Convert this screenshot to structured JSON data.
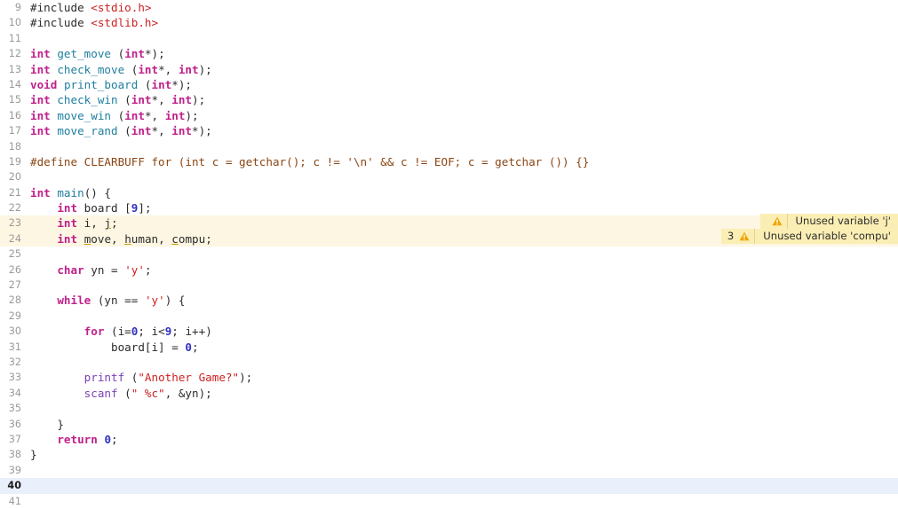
{
  "editor": {
    "first_line_number": 9,
    "active_line_number": 40,
    "warning_line_numbers": [
      23,
      24
    ],
    "colors": {
      "background": "#ffffff",
      "keyword": "#c0208a",
      "function": "#1f7f9e",
      "call": "#7b3fb8",
      "string": "#cc2222",
      "number": "#3030c0",
      "preprocessor": "#8b4513",
      "identifier": "#2b2b2b",
      "line_number": "#9a9a9a",
      "warning_line_highlight": "#fdf6e3",
      "active_line_highlight": "#eaf0fb",
      "warning_badge_background": "#fbeeb4",
      "warning_icon": "#f0a500"
    }
  },
  "lines": [
    {
      "n": 9,
      "state": "normal",
      "tokens": [
        {
          "t": "#include ",
          "c": "id"
        },
        {
          "t": "<stdio.h>",
          "c": "str"
        }
      ]
    },
    {
      "n": 10,
      "state": "normal",
      "tokens": [
        {
          "t": "#include ",
          "c": "id"
        },
        {
          "t": "<stdlib.h>",
          "c": "str"
        }
      ]
    },
    {
      "n": 11,
      "state": "normal",
      "tokens": []
    },
    {
      "n": 12,
      "state": "normal",
      "tokens": [
        {
          "t": "int",
          "c": "k"
        },
        {
          "t": " ",
          "c": "id"
        },
        {
          "t": "get_move",
          "c": "fn"
        },
        {
          "t": " (",
          "c": "id"
        },
        {
          "t": "int",
          "c": "k"
        },
        {
          "t": "*);",
          "c": "id"
        }
      ]
    },
    {
      "n": 13,
      "state": "normal",
      "tokens": [
        {
          "t": "int",
          "c": "k"
        },
        {
          "t": " ",
          "c": "id"
        },
        {
          "t": "check_move",
          "c": "fn"
        },
        {
          "t": " (",
          "c": "id"
        },
        {
          "t": "int",
          "c": "k"
        },
        {
          "t": "*, ",
          "c": "id"
        },
        {
          "t": "int",
          "c": "k"
        },
        {
          "t": ");",
          "c": "id"
        }
      ]
    },
    {
      "n": 14,
      "state": "normal",
      "tokens": [
        {
          "t": "void",
          "c": "k"
        },
        {
          "t": " ",
          "c": "id"
        },
        {
          "t": "print_board",
          "c": "fn"
        },
        {
          "t": " (",
          "c": "id"
        },
        {
          "t": "int",
          "c": "k"
        },
        {
          "t": "*);",
          "c": "id"
        }
      ]
    },
    {
      "n": 15,
      "state": "normal",
      "tokens": [
        {
          "t": "int",
          "c": "k"
        },
        {
          "t": " ",
          "c": "id"
        },
        {
          "t": "check_win",
          "c": "fn"
        },
        {
          "t": " (",
          "c": "id"
        },
        {
          "t": "int",
          "c": "k"
        },
        {
          "t": "*, ",
          "c": "id"
        },
        {
          "t": "int",
          "c": "k"
        },
        {
          "t": ");",
          "c": "id"
        }
      ]
    },
    {
      "n": 16,
      "state": "normal",
      "tokens": [
        {
          "t": "int",
          "c": "k"
        },
        {
          "t": " ",
          "c": "id"
        },
        {
          "t": "move_win",
          "c": "fn"
        },
        {
          "t": " (",
          "c": "id"
        },
        {
          "t": "int",
          "c": "k"
        },
        {
          "t": "*, ",
          "c": "id"
        },
        {
          "t": "int",
          "c": "k"
        },
        {
          "t": ");",
          "c": "id"
        }
      ]
    },
    {
      "n": 17,
      "state": "normal",
      "tokens": [
        {
          "t": "int",
          "c": "k"
        },
        {
          "t": " ",
          "c": "id"
        },
        {
          "t": "move_rand",
          "c": "fn"
        },
        {
          "t": " (",
          "c": "id"
        },
        {
          "t": "int",
          "c": "k"
        },
        {
          "t": "*, ",
          "c": "id"
        },
        {
          "t": "int",
          "c": "k"
        },
        {
          "t": "*);",
          "c": "id"
        }
      ]
    },
    {
      "n": 18,
      "state": "normal",
      "tokens": []
    },
    {
      "n": 19,
      "state": "normal",
      "tokens": [
        {
          "t": "#define CLEARBUFF for (int c = getchar(); c != '\\n' && c != EOF; c = getchar ()) {}",
          "c": "pp"
        }
      ]
    },
    {
      "n": 20,
      "state": "normal",
      "tokens": []
    },
    {
      "n": 21,
      "state": "normal",
      "tokens": [
        {
          "t": "int",
          "c": "k"
        },
        {
          "t": " ",
          "c": "id"
        },
        {
          "t": "main",
          "c": "fn"
        },
        {
          "t": "() {",
          "c": "id"
        }
      ]
    },
    {
      "n": 22,
      "state": "normal",
      "tokens": [
        {
          "t": "    ",
          "c": "id"
        },
        {
          "t": "int",
          "c": "k"
        },
        {
          "t": " board [",
          "c": "id"
        },
        {
          "t": "9",
          "c": "num"
        },
        {
          "t": "];",
          "c": "id"
        }
      ]
    },
    {
      "n": 23,
      "state": "warn",
      "tokens": [
        {
          "t": "    ",
          "c": "id"
        },
        {
          "t": "int",
          "c": "k"
        },
        {
          "t": " i, ",
          "c": "id"
        },
        {
          "t": "j",
          "c": "id",
          "underline": true
        },
        {
          "t": ";",
          "c": "id"
        }
      ]
    },
    {
      "n": 24,
      "state": "warn",
      "tokens": [
        {
          "t": "    ",
          "c": "id"
        },
        {
          "t": "int",
          "c": "k"
        },
        {
          "t": " ",
          "c": "id"
        },
        {
          "t": "m",
          "c": "id",
          "underline": true
        },
        {
          "t": "ove, ",
          "c": "id"
        },
        {
          "t": "h",
          "c": "id",
          "underline": true
        },
        {
          "t": "uman, ",
          "c": "id"
        },
        {
          "t": "c",
          "c": "id",
          "underline": true
        },
        {
          "t": "ompu;",
          "c": "id"
        }
      ]
    },
    {
      "n": 25,
      "state": "normal",
      "tokens": []
    },
    {
      "n": 26,
      "state": "normal",
      "tokens": [
        {
          "t": "    ",
          "c": "id"
        },
        {
          "t": "char",
          "c": "k"
        },
        {
          "t": " yn = ",
          "c": "id"
        },
        {
          "t": "'y'",
          "c": "str"
        },
        {
          "t": ";",
          "c": "id"
        }
      ]
    },
    {
      "n": 27,
      "state": "normal",
      "tokens": []
    },
    {
      "n": 28,
      "state": "normal",
      "tokens": [
        {
          "t": "    ",
          "c": "id"
        },
        {
          "t": "while",
          "c": "k"
        },
        {
          "t": " (yn == ",
          "c": "id"
        },
        {
          "t": "'y'",
          "c": "str"
        },
        {
          "t": ") {",
          "c": "id"
        }
      ]
    },
    {
      "n": 29,
      "state": "normal",
      "tokens": []
    },
    {
      "n": 30,
      "state": "normal",
      "tokens": [
        {
          "t": "        ",
          "c": "id"
        },
        {
          "t": "for",
          "c": "k"
        },
        {
          "t": " (i=",
          "c": "id"
        },
        {
          "t": "0",
          "c": "num"
        },
        {
          "t": "; i<",
          "c": "id"
        },
        {
          "t": "9",
          "c": "num"
        },
        {
          "t": "; i++)",
          "c": "id"
        }
      ]
    },
    {
      "n": 31,
      "state": "normal",
      "tokens": [
        {
          "t": "            board[i] = ",
          "c": "id"
        },
        {
          "t": "0",
          "c": "num"
        },
        {
          "t": ";",
          "c": "id"
        }
      ]
    },
    {
      "n": 32,
      "state": "normal",
      "tokens": []
    },
    {
      "n": 33,
      "state": "normal",
      "tokens": [
        {
          "t": "        ",
          "c": "id"
        },
        {
          "t": "printf",
          "c": "cal"
        },
        {
          "t": " (",
          "c": "id"
        },
        {
          "t": "\"Another Game?\"",
          "c": "str"
        },
        {
          "t": ");",
          "c": "id"
        }
      ]
    },
    {
      "n": 34,
      "state": "normal",
      "tokens": [
        {
          "t": "        ",
          "c": "id"
        },
        {
          "t": "scanf",
          "c": "cal"
        },
        {
          "t": " (",
          "c": "id"
        },
        {
          "t": "\" %c\"",
          "c": "str"
        },
        {
          "t": ", &yn);",
          "c": "id"
        }
      ]
    },
    {
      "n": 35,
      "state": "normal",
      "tokens": []
    },
    {
      "n": 36,
      "state": "normal",
      "tokens": [
        {
          "t": "    }",
          "c": "id"
        }
      ]
    },
    {
      "n": 37,
      "state": "normal",
      "tokens": [
        {
          "t": "    ",
          "c": "id"
        },
        {
          "t": "return",
          "c": "k"
        },
        {
          "t": " ",
          "c": "id"
        },
        {
          "t": "0",
          "c": "num"
        },
        {
          "t": ";",
          "c": "id"
        }
      ]
    },
    {
      "n": 38,
      "state": "normal",
      "tokens": [
        {
          "t": "}",
          "c": "id"
        }
      ]
    },
    {
      "n": 39,
      "state": "normal",
      "tokens": []
    },
    {
      "n": 40,
      "state": "active",
      "tokens": []
    },
    {
      "n": 41,
      "state": "normal",
      "tokens": []
    }
  ],
  "warnings": [
    {
      "count": "",
      "icon": "warning-triangle-icon",
      "message": "Unused variable 'j'"
    },
    {
      "count": "3",
      "icon": "warning-triangle-icon",
      "message": "Unused variable 'compu'"
    }
  ]
}
